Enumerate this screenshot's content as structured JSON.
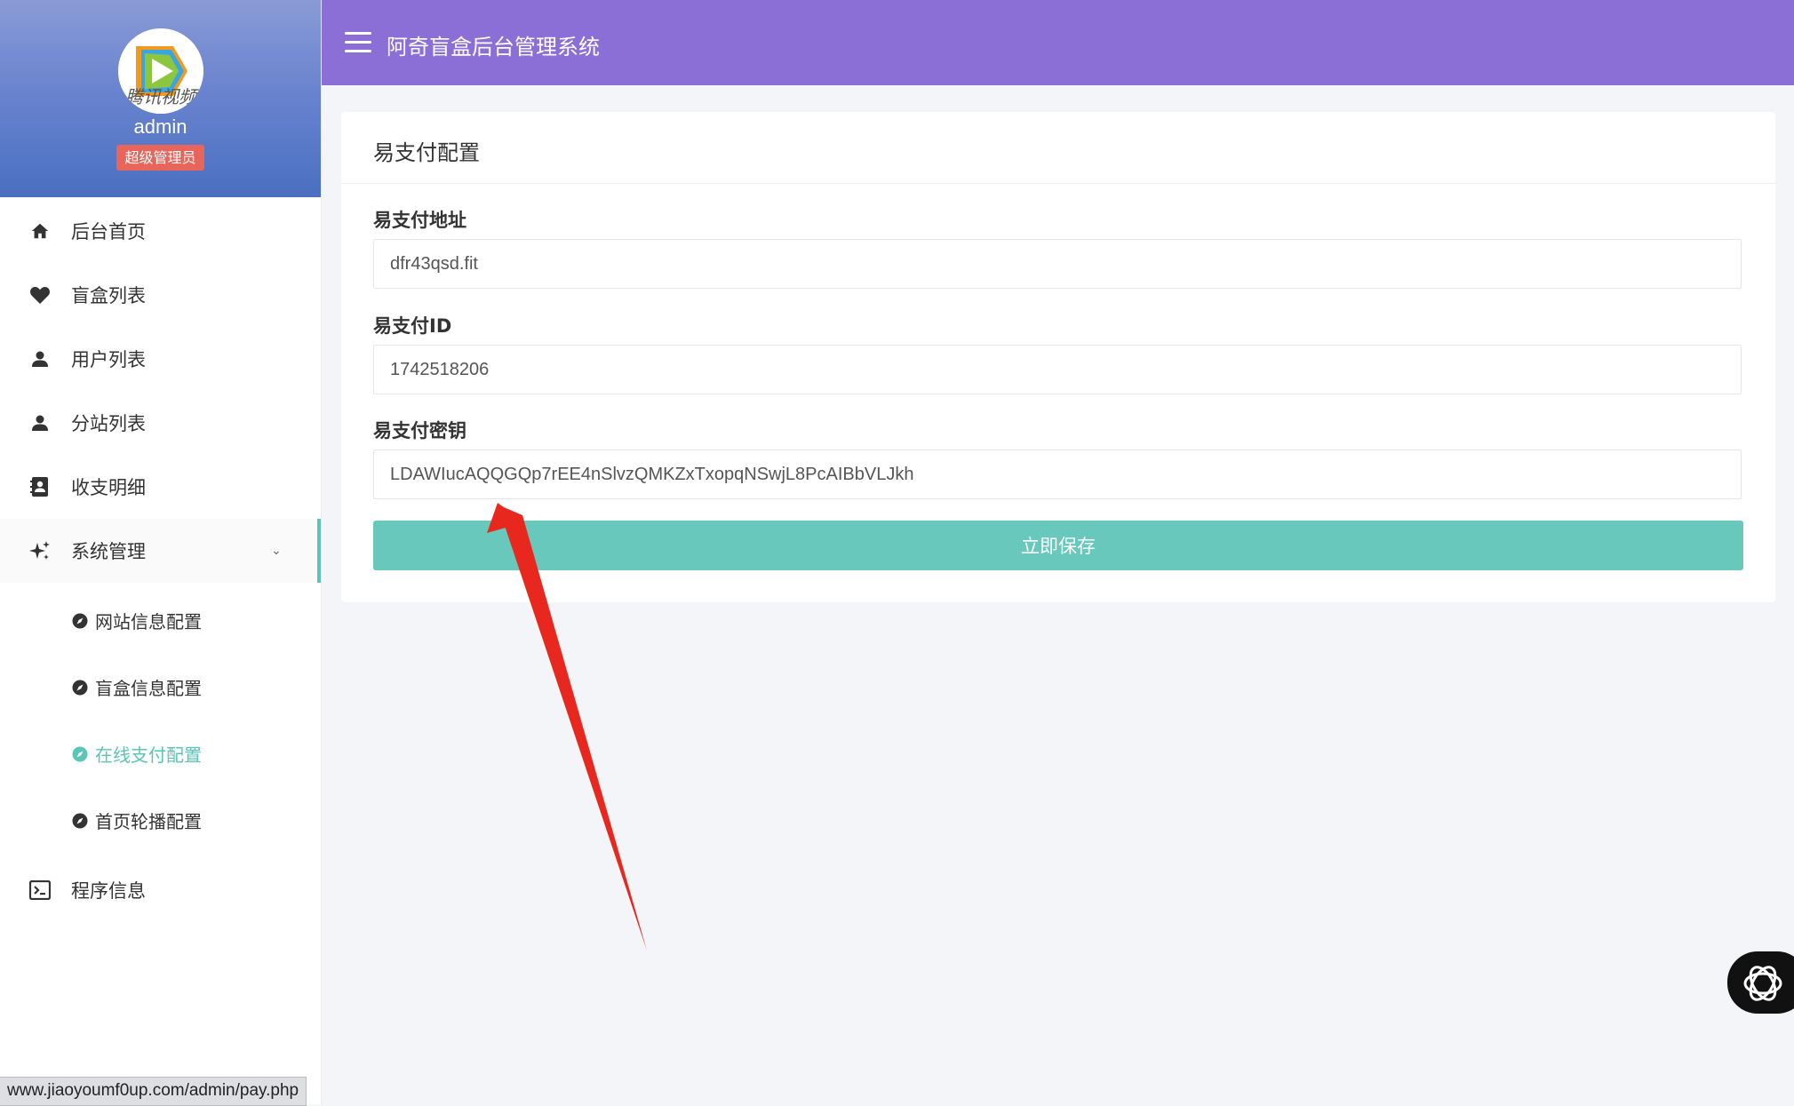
{
  "header": {
    "title": "阿奇盲盒后台管理系统"
  },
  "profile": {
    "username": "admin",
    "role": "超级管理员",
    "avatar_caption": "腾讯视频"
  },
  "sidebar": {
    "items": [
      {
        "label": "后台首页",
        "icon": "home-icon"
      },
      {
        "label": "盲盒列表",
        "icon": "heart-icon"
      },
      {
        "label": "用户列表",
        "icon": "user-icon"
      },
      {
        "label": "分站列表",
        "icon": "user-icon"
      },
      {
        "label": "收支明细",
        "icon": "contact-book-icon"
      },
      {
        "label": "系统管理",
        "icon": "sparkle-icon",
        "expanded": true
      },
      {
        "label": "程序信息",
        "icon": "terminal-icon"
      }
    ],
    "subitems": [
      {
        "label": "网站信息配置",
        "icon": "compass-icon"
      },
      {
        "label": "盲盒信息配置",
        "icon": "compass-icon"
      },
      {
        "label": "在线支付配置",
        "icon": "compass-icon",
        "active": true
      },
      {
        "label": "首页轮播配置",
        "icon": "compass-icon"
      }
    ]
  },
  "card": {
    "title": "易支付配置",
    "fields": [
      {
        "label": "易支付地址",
        "value": "dfr43qsd.fit"
      },
      {
        "label": "易支付ID",
        "value": "1742518206"
      },
      {
        "label": "易支付密钥",
        "value": "LDAWIucAQQGQp7rEE4nSlvzQMKZxTxopqNSwjL8PcAIBbVLJkh"
      }
    ],
    "save_label": "立即保存"
  },
  "statusbar": {
    "url": "www.jiaoyoumf0up.com/admin/pay.php"
  },
  "colors": {
    "header_bg": "#8b6fd7",
    "accent": "#67c8bb",
    "badge": "#e8655b",
    "annotation": "#e8281f"
  }
}
